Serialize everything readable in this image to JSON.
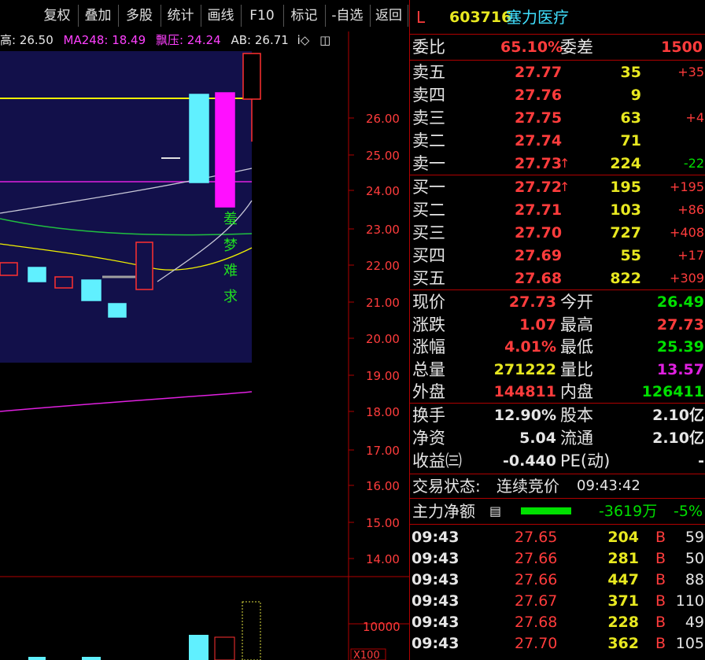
{
  "toolbar": {
    "buttons": [
      "复权",
      "叠加",
      "多股",
      "统计",
      "画线",
      "F10",
      "标记",
      "-自选",
      "返回"
    ]
  },
  "indicators": {
    "high": "高: 26.50",
    "ma248": "MA248: 18.49",
    "press": "飘压: 24.24",
    "ab": "AB: 26.71",
    "icon_i": "i◇",
    "icon_box": "◫"
  },
  "price_axis": [
    "26.00",
    "25.00",
    "24.00",
    "23.00",
    "22.00",
    "21.00",
    "20.00",
    "19.00",
    "18.00",
    "17.00",
    "16.00",
    "15.00",
    "14.00"
  ],
  "volume_axis": {
    "label": "10000",
    "unit": "X100"
  },
  "annotation_chars": [
    "羞",
    "梦",
    "难",
    "求"
  ],
  "header": {
    "letter": "L",
    "code": "603716",
    "name": "塞力医疗"
  },
  "weibi": {
    "label": "委比",
    "value": "65.10%",
    "label2": "委差",
    "value2": "1500"
  },
  "asks": [
    {
      "label": "卖五",
      "price": "27.77",
      "vol": "35",
      "chg": "+35",
      "arrow": ""
    },
    {
      "label": "卖四",
      "price": "27.76",
      "vol": "9",
      "chg": "",
      "arrow": ""
    },
    {
      "label": "卖三",
      "price": "27.75",
      "vol": "63",
      "chg": "+4",
      "arrow": ""
    },
    {
      "label": "卖二",
      "price": "27.74",
      "vol": "71",
      "chg": "",
      "arrow": ""
    },
    {
      "label": "卖一",
      "price": "27.73",
      "vol": "224",
      "chg": "-22",
      "arrow": "↑"
    }
  ],
  "bids": [
    {
      "label": "买一",
      "price": "27.72",
      "vol": "195",
      "chg": "+195",
      "arrow": "↑"
    },
    {
      "label": "买二",
      "price": "27.71",
      "vol": "103",
      "chg": "+86",
      "arrow": ""
    },
    {
      "label": "买三",
      "price": "27.70",
      "vol": "727",
      "chg": "+408",
      "arrow": ""
    },
    {
      "label": "买四",
      "price": "27.69",
      "vol": "55",
      "chg": "+17",
      "arrow": ""
    },
    {
      "label": "买五",
      "price": "27.68",
      "vol": "822",
      "chg": "+309",
      "arrow": ""
    }
  ],
  "quote": [
    {
      "l1": "现价",
      "v1": "27.73",
      "l2": "今开",
      "v2": "26.49",
      "c1": "red",
      "c2": "green"
    },
    {
      "l1": "涨跌",
      "v1": "1.07",
      "l2": "最高",
      "v2": "27.73",
      "c1": "red",
      "c2": "red"
    },
    {
      "l1": "涨幅",
      "v1": "4.01%",
      "l2": "最低",
      "v2": "25.39",
      "c1": "red",
      "c2": "green"
    },
    {
      "l1": "总量",
      "v1": "271222",
      "l2": "量比",
      "v2": "13.57",
      "c1": "yellow",
      "c2": "magenta"
    },
    {
      "l1": "外盘",
      "v1": "144811",
      "l2": "内盘",
      "v2": "126411",
      "c1": "red",
      "c2": "green"
    }
  ],
  "fundamentals": [
    {
      "l1": "换手",
      "v1": "12.90%",
      "l2": "股本",
      "v2": "2.10亿"
    },
    {
      "l1": "净资",
      "v1": "5.04",
      "l2": "流通",
      "v2": "2.10亿"
    },
    {
      "l1": "收益㈢",
      "v1": "-0.440",
      "l2": "PE(动)",
      "v2": "-"
    }
  ],
  "status": {
    "label": "交易状态:",
    "value": "连续竞价",
    "time": "09:43:42"
  },
  "mainforce": {
    "label": "主力净额",
    "value": "-3619万",
    "pct": "-5%"
  },
  "ticks": [
    {
      "time": "09:43",
      "price": "27.65",
      "vol": "204",
      "side": "B",
      "n": "59"
    },
    {
      "time": "09:43",
      "price": "27.66",
      "vol": "281",
      "side": "B",
      "n": "50"
    },
    {
      "time": "09:43",
      "price": "27.66",
      "vol": "447",
      "side": "B",
      "n": "88"
    },
    {
      "time": "09:43",
      "price": "27.67",
      "vol": "371",
      "side": "B",
      "n": "110"
    },
    {
      "time": "09:43",
      "price": "27.68",
      "vol": "228",
      "side": "B",
      "n": "49"
    },
    {
      "time": "09:43",
      "price": "27.70",
      "vol": "362",
      "side": "B",
      "n": "105"
    }
  ]
}
